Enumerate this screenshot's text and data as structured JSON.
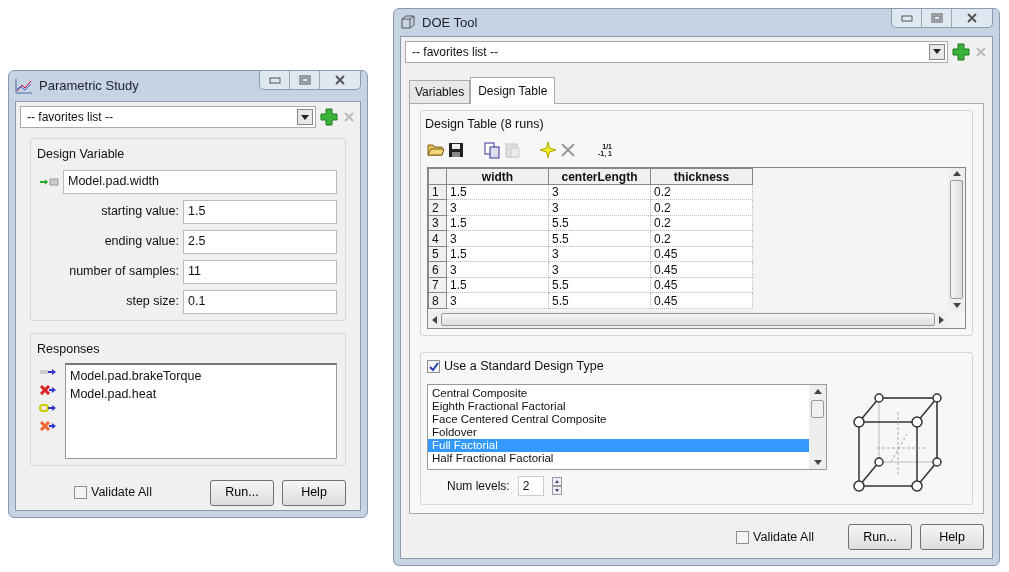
{
  "parametric_window": {
    "title": "Parametric Study",
    "favorites": {
      "value": "-- favorites list --"
    },
    "design_variable": {
      "title": "Design Variable",
      "variable": "Model.pad.width",
      "fields": [
        {
          "label": "starting value:",
          "value": "1.5"
        },
        {
          "label": "ending value:",
          "value": "2.5"
        },
        {
          "label": "number of samples:",
          "value": "11"
        },
        {
          "label": "step size:",
          "value": "0.1"
        }
      ]
    },
    "responses": {
      "title": "Responses",
      "tools": [
        {
          "kind": "add"
        },
        {
          "kind": "remove"
        },
        {
          "kind": "link"
        },
        {
          "kind": "remove_all"
        }
      ],
      "items": [
        "Model.pad.brakeTorque",
        "Model.pad.heat"
      ]
    },
    "validate_all": {
      "label": "Validate All",
      "checked": false
    },
    "buttons": [
      "Run...",
      "Help"
    ]
  },
  "doe_window": {
    "title": "DOE Tool",
    "favorites": {
      "value": "-- favorites list --"
    },
    "tabs": [
      {
        "label": "Variables",
        "selected": false
      },
      {
        "label": "Design Table",
        "selected": true
      }
    ],
    "design_table": {
      "title": "Design Table (8 runs)",
      "toolbar": [
        {
          "kind": "open",
          "disabled": false
        },
        {
          "kind": "save",
          "disabled": false
        },
        {
          "kind": "copy",
          "disabled": false
        },
        {
          "kind": "paste",
          "disabled": true
        },
        {
          "kind": "new",
          "disabled": false
        },
        {
          "kind": "delete",
          "disabled": false
        },
        {
          "kind": "coded",
          "disabled": false,
          "top": "1/1",
          "bottom": "-1, 1"
        }
      ],
      "columns": [
        "width",
        "centerLength",
        "thickness"
      ],
      "rows": [
        {
          "index": "1",
          "cells": [
            "1.5",
            "3",
            "0.2"
          ]
        },
        {
          "index": "2",
          "cells": [
            "3",
            "3",
            "0.2"
          ]
        },
        {
          "index": "3",
          "cells": [
            "1.5",
            "5.5",
            "0.2"
          ]
        },
        {
          "index": "4",
          "cells": [
            "3",
            "5.5",
            "0.2"
          ]
        },
        {
          "index": "5",
          "cells": [
            "1.5",
            "3",
            "0.45"
          ]
        },
        {
          "index": "6",
          "cells": [
            "3",
            "3",
            "0.45"
          ]
        },
        {
          "index": "7",
          "cells": [
            "1.5",
            "5.5",
            "0.45"
          ]
        },
        {
          "index": "8",
          "cells": [
            "3",
            "5.5",
            "0.45"
          ]
        }
      ]
    },
    "standard_design": {
      "label": "Use a Standard Design Type",
      "checked": true,
      "types": [
        {
          "label": "Central Composite",
          "selected": false
        },
        {
          "label": "Eighth Fractional Factorial",
          "selected": false
        },
        {
          "label": "Face Centered Central Composite",
          "selected": false
        },
        {
          "label": "Foldover",
          "selected": false
        },
        {
          "label": "Full Factorial",
          "selected": true
        },
        {
          "label": "Half Fractional Factorial",
          "selected": false
        }
      ],
      "num_levels": {
        "label": "Num levels:",
        "value": "2"
      }
    },
    "validate_all": {
      "label": "Validate All",
      "checked": false
    },
    "buttons": [
      "Run...",
      "Help"
    ]
  }
}
